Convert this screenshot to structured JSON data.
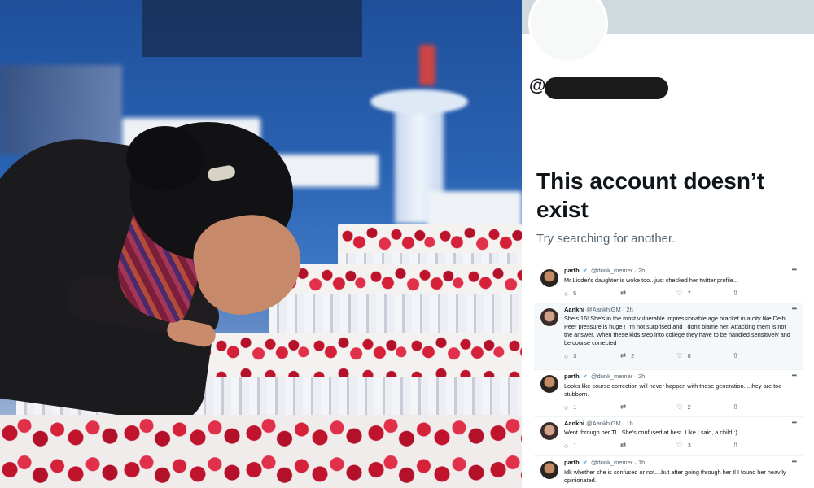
{
  "profile": {
    "handle_prefix": "@a",
    "title": "This account doesn’t exist",
    "subtitle": "Try searching for another."
  },
  "icons": {
    "reply": "reply-icon",
    "retweet": "retweet-icon",
    "like": "heart-icon",
    "share": "share-icon",
    "more": "more-icon",
    "verified": "verified-badge-icon"
  },
  "tweets": [
    {
      "name": "parth",
      "handle_time": "@dunk_memer · 2h",
      "text": "Mr Lidder's daughter is woke too...just checked her twitter profile...",
      "replies": "5",
      "retweets": "",
      "likes": "7"
    },
    {
      "name": "Aankhi",
      "handle_time": "@AankhiGM · 2h",
      "text": "She's 16! She's in the most vulnerable impressionable age bracket in a city like Delhi. Peer pressure is huge ! I'm not surprised and I don't blame her. Attacking them is not the answer. When these kids step into college they have to be handled sensitively and be course corrected",
      "replies": "3",
      "retweets": "2",
      "likes": "8"
    },
    {
      "name": "parth",
      "handle_time": "@dunk_memer · 2h",
      "text": "Looks like course correction will never happen with these generation....they are too stubborn.",
      "replies": "1",
      "retweets": "",
      "likes": "2"
    },
    {
      "name": "Aankhi",
      "handle_time": "@AankhiGM · 1h",
      "text": "Went through her TL. She's confused at best. Like I said, a child :)",
      "replies": "1",
      "retweets": "",
      "likes": "3"
    },
    {
      "name": "parth",
      "handle_time": "@dunk_memer · 1h",
      "text": "Idk whether she is confused or not....but after going through her tl I found her heavily opinionated.",
      "replies": "",
      "retweets": "",
      "likes": ""
    }
  ]
}
